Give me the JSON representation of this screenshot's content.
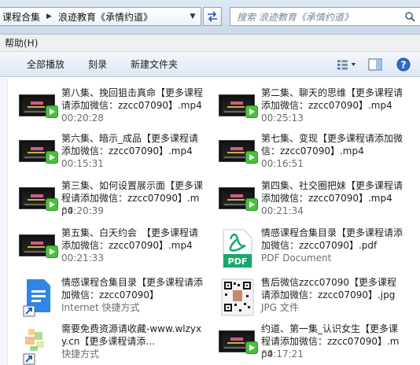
{
  "address": {
    "crumbs": [
      "课程合集",
      "浪迹教育《承情约道》"
    ],
    "search_placeholder": "搜索 浪迹教育《承情约道》"
  },
  "menu": {
    "help": "帮助(H)"
  },
  "toolbar": {
    "play_all": "全部播放",
    "burn": "刻录",
    "new_folder": "新建文件夹"
  },
  "files": [
    {
      "name": "第八集、挽回狙击真命【更多课程请添加微信：zzcc07090】.mp4",
      "meta": "00:20:28",
      "kind": "video"
    },
    {
      "name": "第二集、聊天的思维【更多课程请添加微信：zzcc07090】.mp4",
      "meta": "00:25:13",
      "kind": "video"
    },
    {
      "name": "第六集、暗示_成品【更多课程请添加微信：zzcc07090】.mp4",
      "meta": "00:15:31",
      "kind": "video"
    },
    {
      "name": "第七集、变现【更多课程请添加微信：zzcc07090】.mp4",
      "meta": "00:16:51",
      "kind": "video"
    },
    {
      "name": "第三集、如何设置展示面【更多课程请添加微信：zzcc07090】.mp4",
      "meta": "00:20:39",
      "kind": "video"
    },
    {
      "name": "第四集、社交圈把妹【更多课程请添加微信：zzcc07090】.mp4",
      "meta": "00:21:34",
      "kind": "video"
    },
    {
      "name": "第五集、白天约会　【更多课程请添加微信：zzcc07090】.mp4",
      "meta": "00:21:33",
      "kind": "video"
    },
    {
      "name": "情感课程合集目录【更多课程请添加微信：zzcc07090】.pdf",
      "meta": "PDF Document",
      "kind": "pdf"
    },
    {
      "name": "情感课程合集目录【更多课程请添加微信：zzcc07090】",
      "meta": "Internet 快捷方式",
      "kind": "url"
    },
    {
      "name": "售后微信zzcc07090【更多课程请添加微信：zzcc07090】.jpg",
      "meta": "JPG 文件",
      "kind": "jpg"
    },
    {
      "name": "需要免费资源请收藏-www.wlzyxy.cn【更多课程请添…",
      "meta": "快捷方式",
      "kind": "lnk"
    },
    {
      "name": "约道、第一集_认识女生【更多课程请添加微信：zzcc07090】.mp4",
      "meta": "00:17:21",
      "kind": "video"
    }
  ]
}
